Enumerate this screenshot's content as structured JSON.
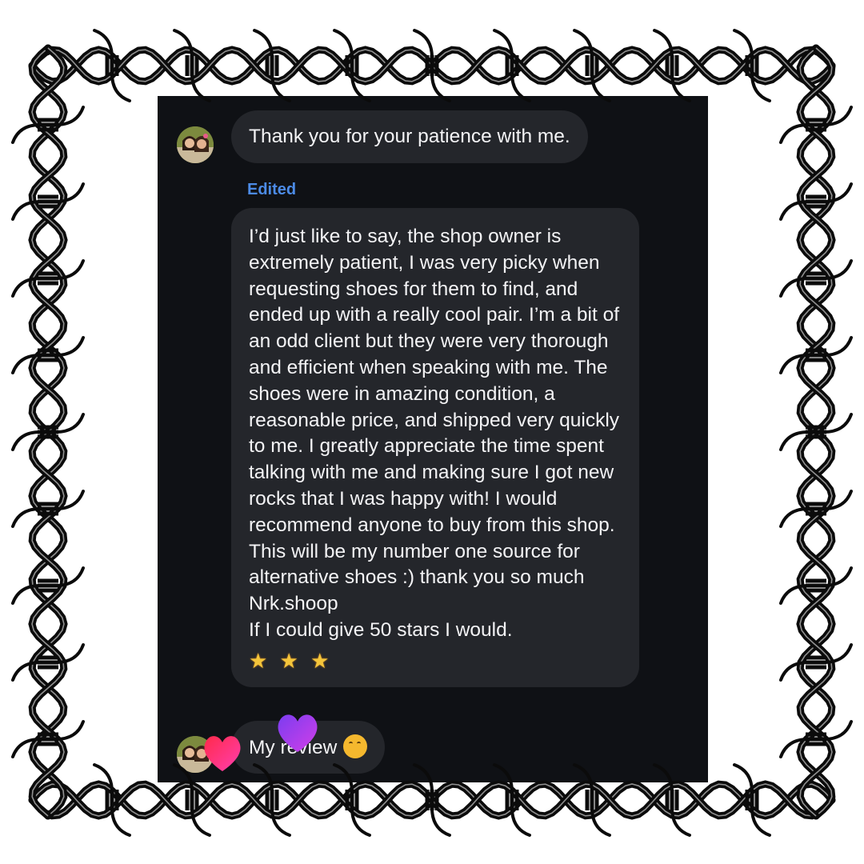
{
  "messages": [
    {
      "text": "Thank you for your patience with me."
    },
    {
      "edited_label": "Edited",
      "paragraphs": [
        "I’d just like to say, the shop owner is extremely patient, I was very picky when requesting shoes for them to find, and ended up with a really cool pair. I’m a bit of an odd client but they were very thorough and efficient when speaking with me. The shoes were in amazing condition, a reasonable price, and shipped very quickly to me. I greatly appreciate the time spent talking with me and making sure I got new rocks that I was happy with! I would recommend anyone to buy from this shop. This will be my number one source for alternative shoes :) thank you so much Nrk.shoop",
        "If I could give 50 stars I would."
      ],
      "stars": "★ ★ ★"
    },
    {
      "text": "My review"
    }
  ],
  "icons": {
    "avatar": "avatar-photo",
    "star": "glowing-star-emoji",
    "face": "face-with-hand-over-mouth-emoji",
    "heart_red": "red-heart-sticker",
    "heart_purple": "purple-heart-sticker",
    "frame": "barbed-wire-frame"
  },
  "colors": {
    "screen_bg": "#0f1115",
    "bubble_bg": "#24262b",
    "text": "#f3f3f5",
    "edited": "#4c8be6"
  }
}
